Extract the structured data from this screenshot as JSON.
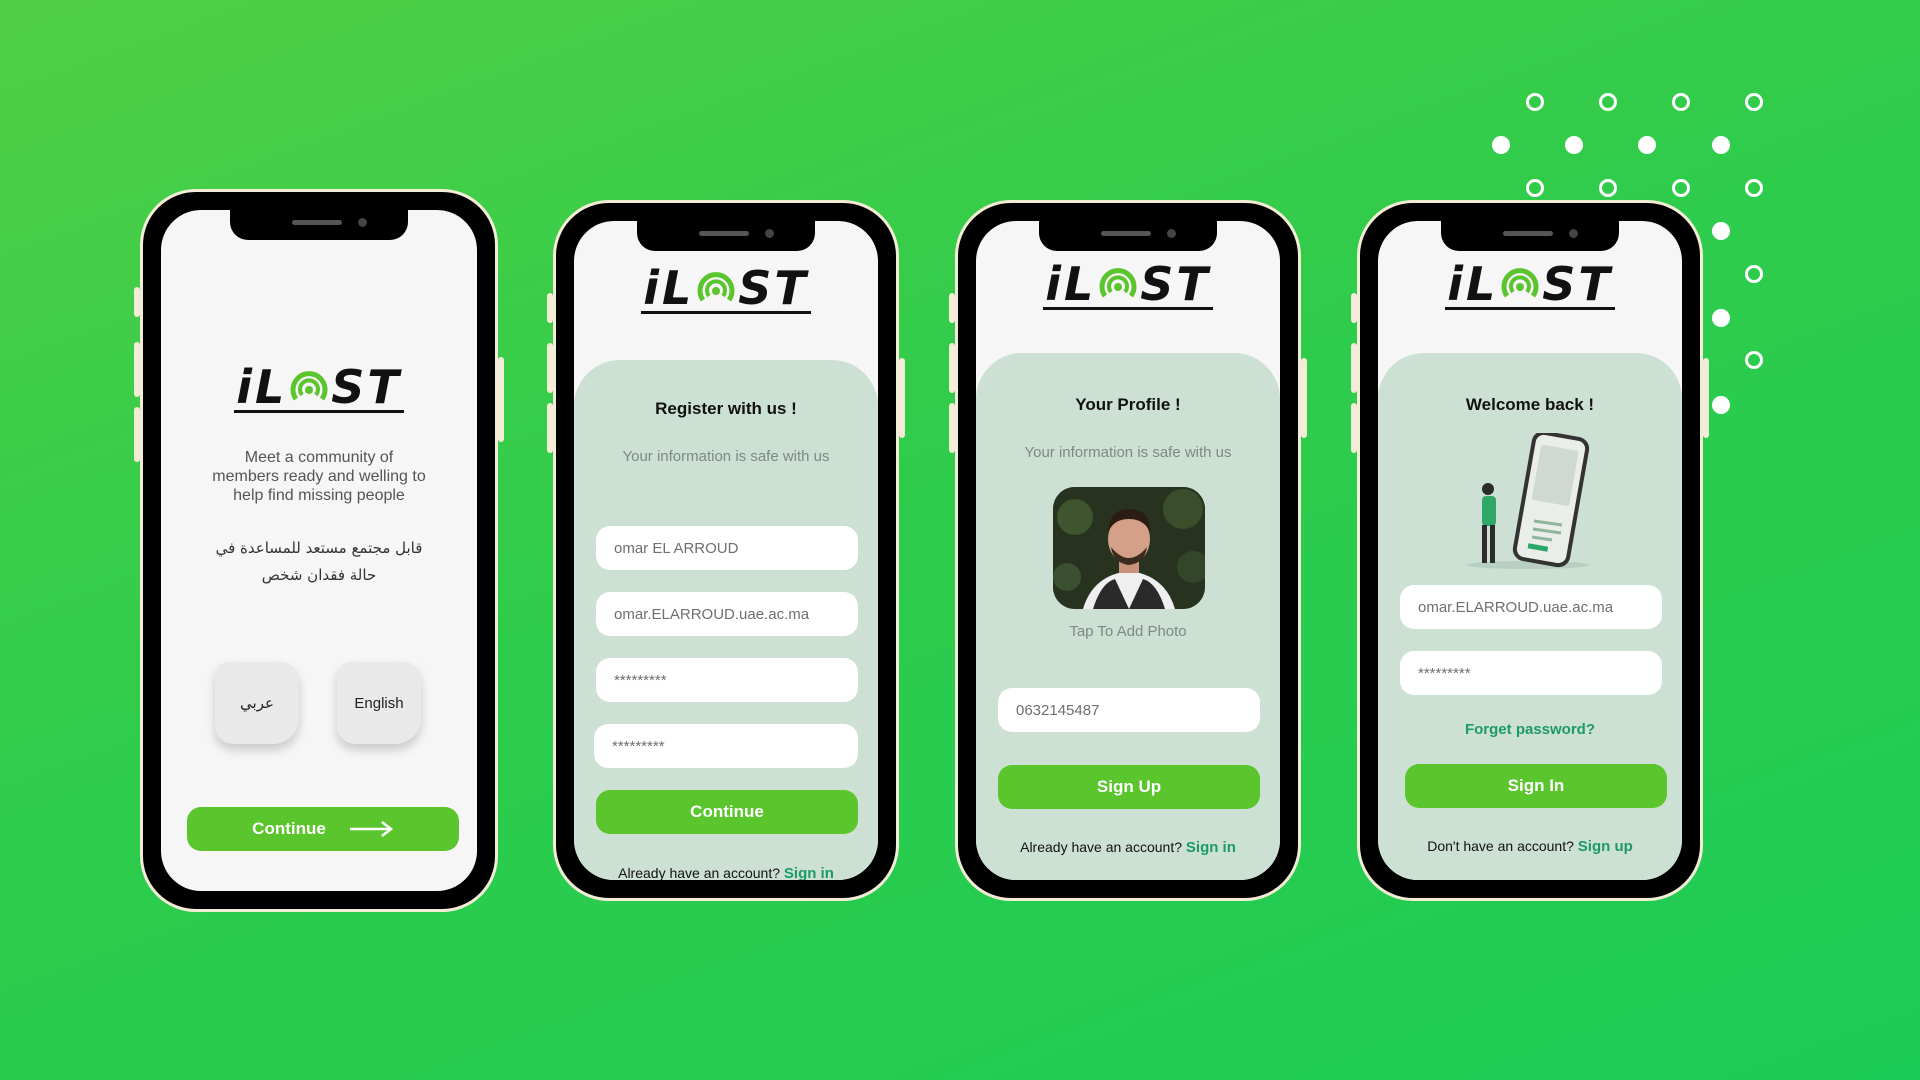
{
  "colors": {
    "accent": "#5ac52c",
    "link": "#1c9a6a",
    "panel": "#cde0d4",
    "logo_ring": "#5ac52c"
  },
  "logo": {
    "part1": "iL",
    "part2": "ST",
    "icon": "location-signal-icon"
  },
  "screen1": {
    "tagline": [
      "Meet a community of",
      "members ready and welling to",
      "help find missing people"
    ],
    "arabic": [
      "قابل مجتمع مستعد للمساعدة في",
      "حالة فقدان شخص"
    ],
    "lang_ar": "عربي",
    "lang_en": "English",
    "continue": "Continue",
    "arrow_icon": "arrow-right-icon"
  },
  "screen2": {
    "title": "Register with us !",
    "subtitle": "Your information  is safe with us",
    "name_value": "omar EL ARROUD",
    "email_value": "omar.ELARROUD.uae.ac.ma",
    "password_value": "*********",
    "confirm_value": "*********",
    "continue": "Continue",
    "footer_text": "Already have an account?",
    "footer_link": "Sign in"
  },
  "screen3": {
    "title": "Your Profile !",
    "subtitle": "Your information  is safe with us",
    "photo_caption": "Tap To Add Photo",
    "phone_value": "0632145487",
    "signup": "Sign Up",
    "footer_text": "Already have an account?",
    "footer_link": "Sign in"
  },
  "screen4": {
    "title": "Welcome back !",
    "email_value": "omar.ELARROUD.uae.ac.ma",
    "password_value": "*********",
    "forgot": "Forget password?",
    "signin": "Sign In",
    "footer_text": "Don't have an account?",
    "footer_link": "Sign up"
  }
}
